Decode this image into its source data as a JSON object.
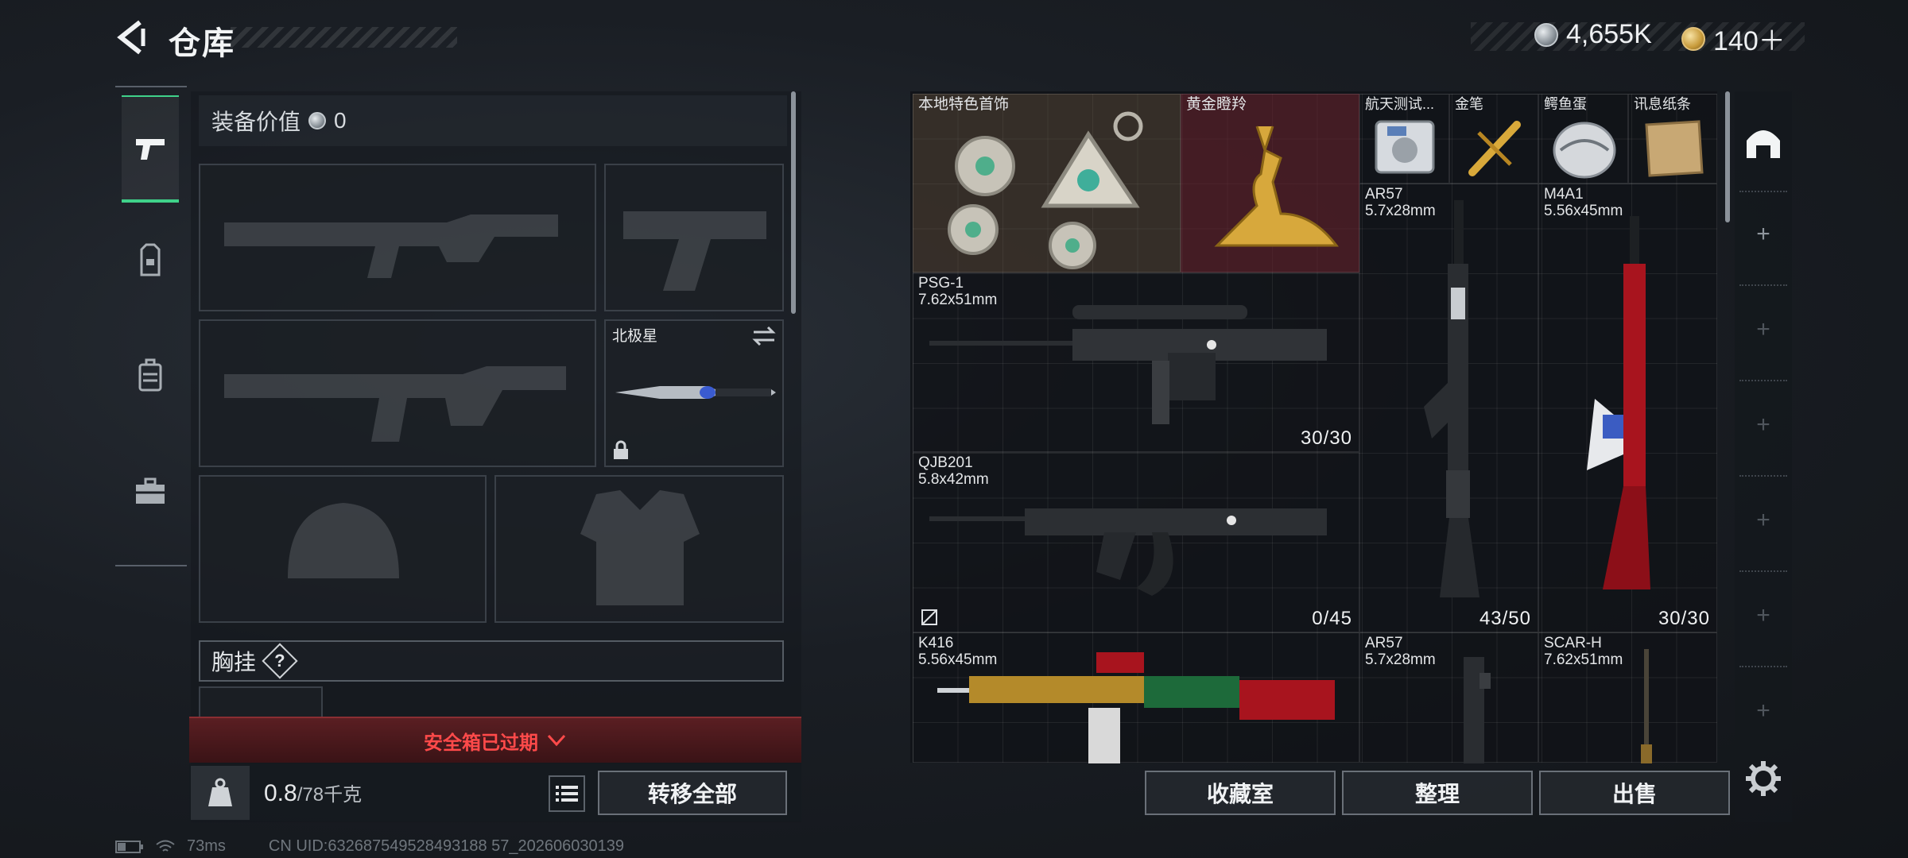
{
  "header": {
    "title": "仓库",
    "currency": [
      {
        "icon": "silver-coin-icon",
        "value": "4,655K"
      },
      {
        "icon": "gold-coin-icon",
        "value": "140＋"
      }
    ]
  },
  "equipment": {
    "value_label": "装备价值",
    "value": "0",
    "melee_name": "北极星",
    "chest_rig_label": "胸挂",
    "chest_rig_badge": "?",
    "safe_box_status": "安全箱已过期",
    "weight": "0.8",
    "weight_max": "/78千克",
    "weight_icon_text": "KG",
    "transfer_all": "转移全部"
  },
  "storage": {
    "items": [
      {
        "name": "本地特色首饰"
      },
      {
        "name": "黄金瞪羚"
      },
      {
        "name": "航天测试..."
      },
      {
        "name": "金笔"
      },
      {
        "name": "鳄鱼蛋"
      },
      {
        "name": "讯息纸条"
      },
      {
        "name": "AR57",
        "caliber": "5.7x28mm",
        "ammo": "43/50"
      },
      {
        "name": "M4A1",
        "caliber": "5.56x45mm",
        "ammo": "30/30"
      },
      {
        "name": "PSG-1",
        "caliber": "7.62x51mm",
        "ammo": "30/30"
      },
      {
        "name": "QJB201",
        "caliber": "5.8x42mm",
        "ammo": "0/45"
      },
      {
        "name": "K416",
        "caliber": "5.56x45mm"
      },
      {
        "name": "AR57",
        "caliber": "5.7x28mm"
      },
      {
        "name": "SCAR-H",
        "caliber": "7.62x51mm"
      }
    ],
    "buttons": {
      "collection": "收藏室",
      "sort": "整理",
      "sell": "出售"
    }
  },
  "footer": {
    "ping": "73ms",
    "uid": "CN UID:632687549528493188 57_202606030139"
  },
  "colors": {
    "accent_green": "#3fd28a",
    "alert_red": "#ff4a4a"
  }
}
